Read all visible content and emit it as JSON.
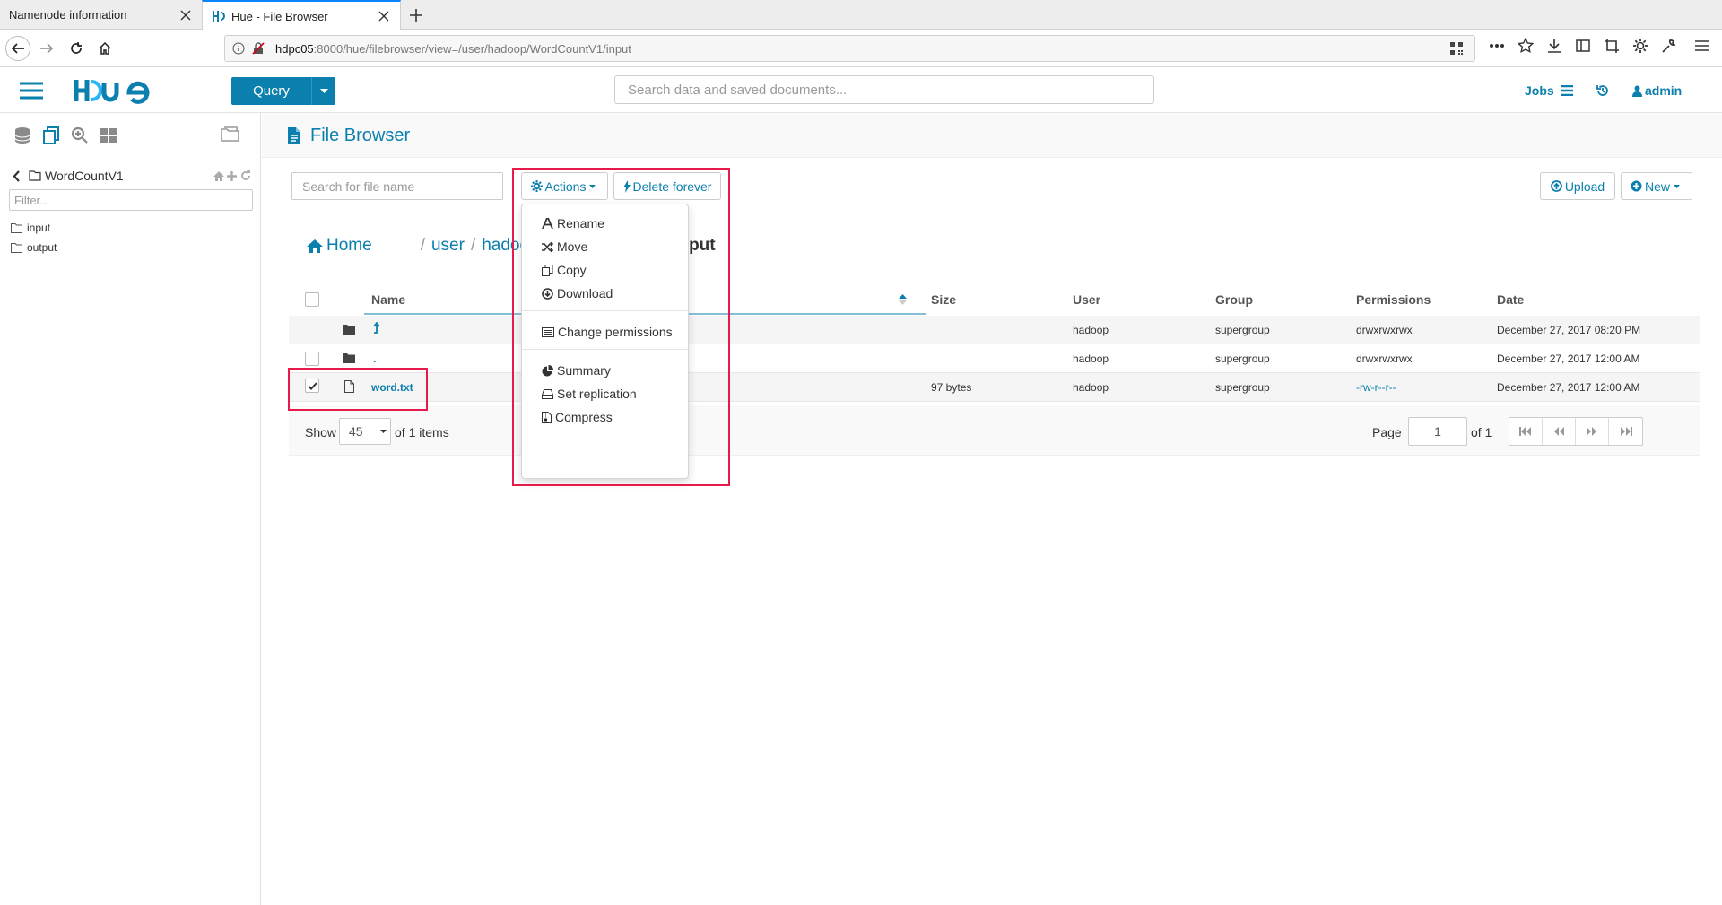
{
  "browser": {
    "tabs": [
      {
        "label": "Namenode information"
      },
      {
        "label": "Hue - File Browser"
      }
    ],
    "url_host": "hdpc05",
    "url_rest": ":8000/hue/filebrowser/view=/user/hadoop/WordCountV1/input"
  },
  "header": {
    "query_label": "Query",
    "search_placeholder": "Search data and saved documents...",
    "jobs_label": "Jobs",
    "user_label": "admin"
  },
  "sidebar": {
    "folder_title": "WordCountV1",
    "filter_placeholder": "Filter...",
    "items": [
      {
        "label": "input"
      },
      {
        "label": "output"
      }
    ]
  },
  "main": {
    "title": "File Browser",
    "file_search_placeholder": "Search for file name",
    "actions_label": "Actions",
    "delete_label": "Delete forever",
    "upload_label": "Upload",
    "new_label": "New",
    "breadcrumbs": {
      "home": "Home",
      "user": "user",
      "hadoop_partial": "hadoo",
      "current_partial": "put"
    },
    "columns": {
      "name": "Name",
      "size": "Size",
      "user": "User",
      "group": "Group",
      "permissions": "Permissions",
      "date": "Date"
    },
    "rows": [
      {
        "name": "",
        "size": "",
        "user": "hadoop",
        "group": "supergroup",
        "permissions": "drwxrwxrwx",
        "date": "December 27, 2017 08:20 PM",
        "checked": false
      },
      {
        "name": ".",
        "size": "",
        "user": "hadoop",
        "group": "supergroup",
        "permissions": "drwxrwxrwx",
        "date": "December 27, 2017 12:00 AM",
        "checked": false
      },
      {
        "name": "word.txt",
        "size": "97 bytes",
        "user": "hadoop",
        "group": "supergroup",
        "permissions": "-rw-r--r--",
        "date": "December 27, 2017 12:00 AM",
        "checked": true
      }
    ],
    "pager": {
      "show_label": "Show",
      "page_size": "45",
      "of_items": "of 1 items",
      "page_label": "Page",
      "page_value": "1",
      "of_pages": "of 1"
    }
  },
  "actions_menu": {
    "items": [
      {
        "label": "Rename",
        "icon": "font-icon"
      },
      {
        "label": "Move",
        "icon": "random-icon"
      },
      {
        "label": "Copy",
        "icon": "copy-icon"
      },
      {
        "label": "Download",
        "icon": "download-icon"
      },
      {
        "label": "Change permissions",
        "icon": "list-alt-icon"
      },
      {
        "label": "Summary",
        "icon": "pie-chart-icon"
      },
      {
        "label": "Set replication",
        "icon": "hdd-icon"
      },
      {
        "label": "Compress",
        "icon": "file-archive-icon"
      }
    ]
  },
  "colors": {
    "accent": "#0b7fad",
    "highlight": "#e8194b"
  }
}
